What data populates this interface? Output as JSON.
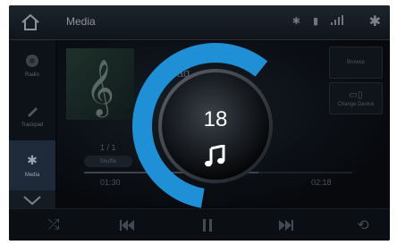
{
  "header": {
    "title": "Media"
  },
  "sidebar": {
    "items": [
      {
        "label": "Radio",
        "icon": "radio-icon"
      },
      {
        "label": "Trackpad",
        "icon": "pen-icon"
      },
      {
        "label": "Media",
        "icon": "bluetooth-icon"
      }
    ]
  },
  "media": {
    "track_title": "Wag",
    "track_number": "1 / 1",
    "shuffle_label": "Shuffle",
    "elapsed": "01:30",
    "total": "02:18",
    "progress": 0.65
  },
  "right_buttons": [
    {
      "label": "Browse"
    },
    {
      "label": "Change Device"
    }
  ],
  "volume": {
    "value": "18",
    "level": 0.58,
    "color": "#1f8fd6"
  }
}
